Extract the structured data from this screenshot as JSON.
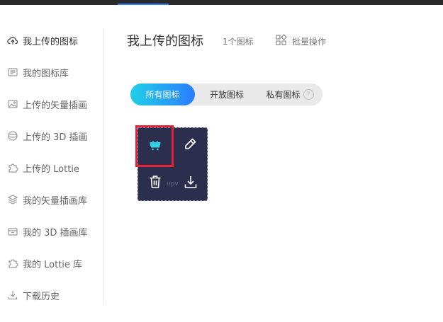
{
  "sidebar": {
    "items": [
      {
        "label": "我上传的图标",
        "icon": "cloud-upload-icon"
      },
      {
        "label": "我的图标库",
        "icon": "library-icon"
      },
      {
        "label": "上传的矢量插画",
        "icon": "image-icon"
      },
      {
        "label": "上传的 3D 插画",
        "icon": "sphere-icon"
      },
      {
        "label": "上传的 Lottie",
        "icon": "puzzle-icon"
      },
      {
        "label": "我的矢量插画库",
        "icon": "layers-icon"
      },
      {
        "label": "我的 3D 插画库",
        "icon": "box-icon"
      },
      {
        "label": "我的 Lottie 库",
        "icon": "puzzle-icon"
      },
      {
        "label": "下载历史",
        "icon": "download-icon"
      }
    ]
  },
  "header": {
    "title": "我上传的图标",
    "count": "1个图标",
    "batch_label": "批量操作"
  },
  "tabs": [
    {
      "label": "所有图标"
    },
    {
      "label": "开放图标"
    },
    {
      "label": "私有图标"
    }
  ],
  "help_glyph": "?",
  "card": {
    "label": "upv",
    "actions": [
      "cart-icon",
      "edit-icon",
      "trash-icon",
      "download-icon"
    ]
  },
  "colors": {
    "accent_cyan": "#1fd0e8",
    "accent_blue": "#2a7dff",
    "card_bg": "#2b2f4d",
    "highlight": "#e8213a",
    "cart": "#2fd3e3"
  }
}
